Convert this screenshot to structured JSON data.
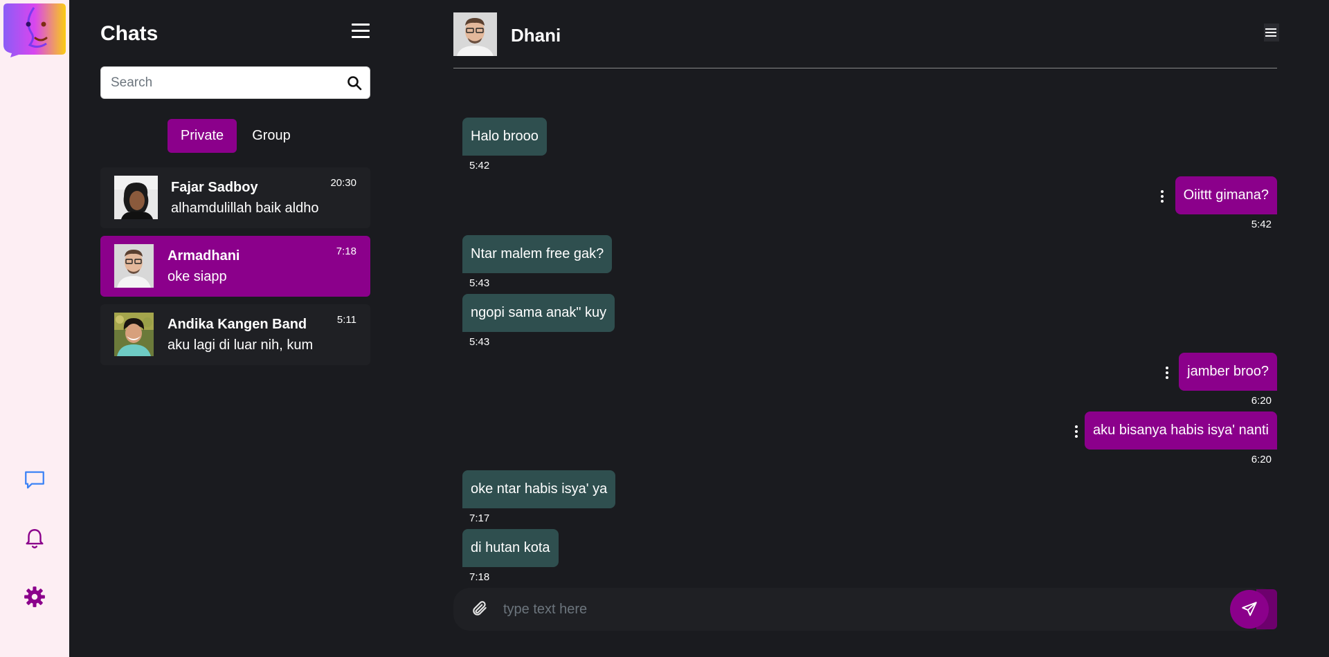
{
  "sidebar": {
    "icons": [
      "chat-bubble-icon",
      "bell-icon",
      "gear-icon"
    ]
  },
  "chats_panel": {
    "title": "Chats",
    "search_placeholder": "Search",
    "tabs": {
      "private": "Private",
      "group": "Group",
      "active": "Private"
    },
    "items": [
      {
        "name": "Fajar Sadboy",
        "message": "alhamdulillah baik aldho",
        "time": "20:30",
        "active": false
      },
      {
        "name": "Armadhani",
        "message": "oke siapp",
        "time": "7:18",
        "active": true
      },
      {
        "name": "Andika Kangen Band",
        "message": "aku lagi di luar nih, kum",
        "time": "5:11",
        "active": false
      }
    ]
  },
  "conversation": {
    "contact_name": "Dhani",
    "messages": [
      {
        "direction": "in",
        "text": "Halo brooo",
        "time": "5:42"
      },
      {
        "direction": "out",
        "text": "Oiittt gimana?",
        "time": "5:42"
      },
      {
        "direction": "in",
        "text": "Ntar malem free gak?",
        "time": "5:43"
      },
      {
        "direction": "in",
        "text": "ngopi sama anak\" kuy",
        "time": "5:43"
      },
      {
        "direction": "out",
        "text": "jamber broo?",
        "time": "6:20"
      },
      {
        "direction": "out",
        "text": "aku bisanya habis isya' nanti",
        "time": "6:20"
      },
      {
        "direction": "in",
        "text": "oke ntar habis isya' ya",
        "time": "7:17"
      },
      {
        "direction": "in",
        "text": "di hutan kota",
        "time": "7:18"
      }
    ],
    "composer_placeholder": "type text here"
  },
  "colors": {
    "accent": "#8b008b",
    "incoming_bubble": "#2f4f4f",
    "background": "#1a1b1f",
    "rail": "#fdeef3"
  }
}
